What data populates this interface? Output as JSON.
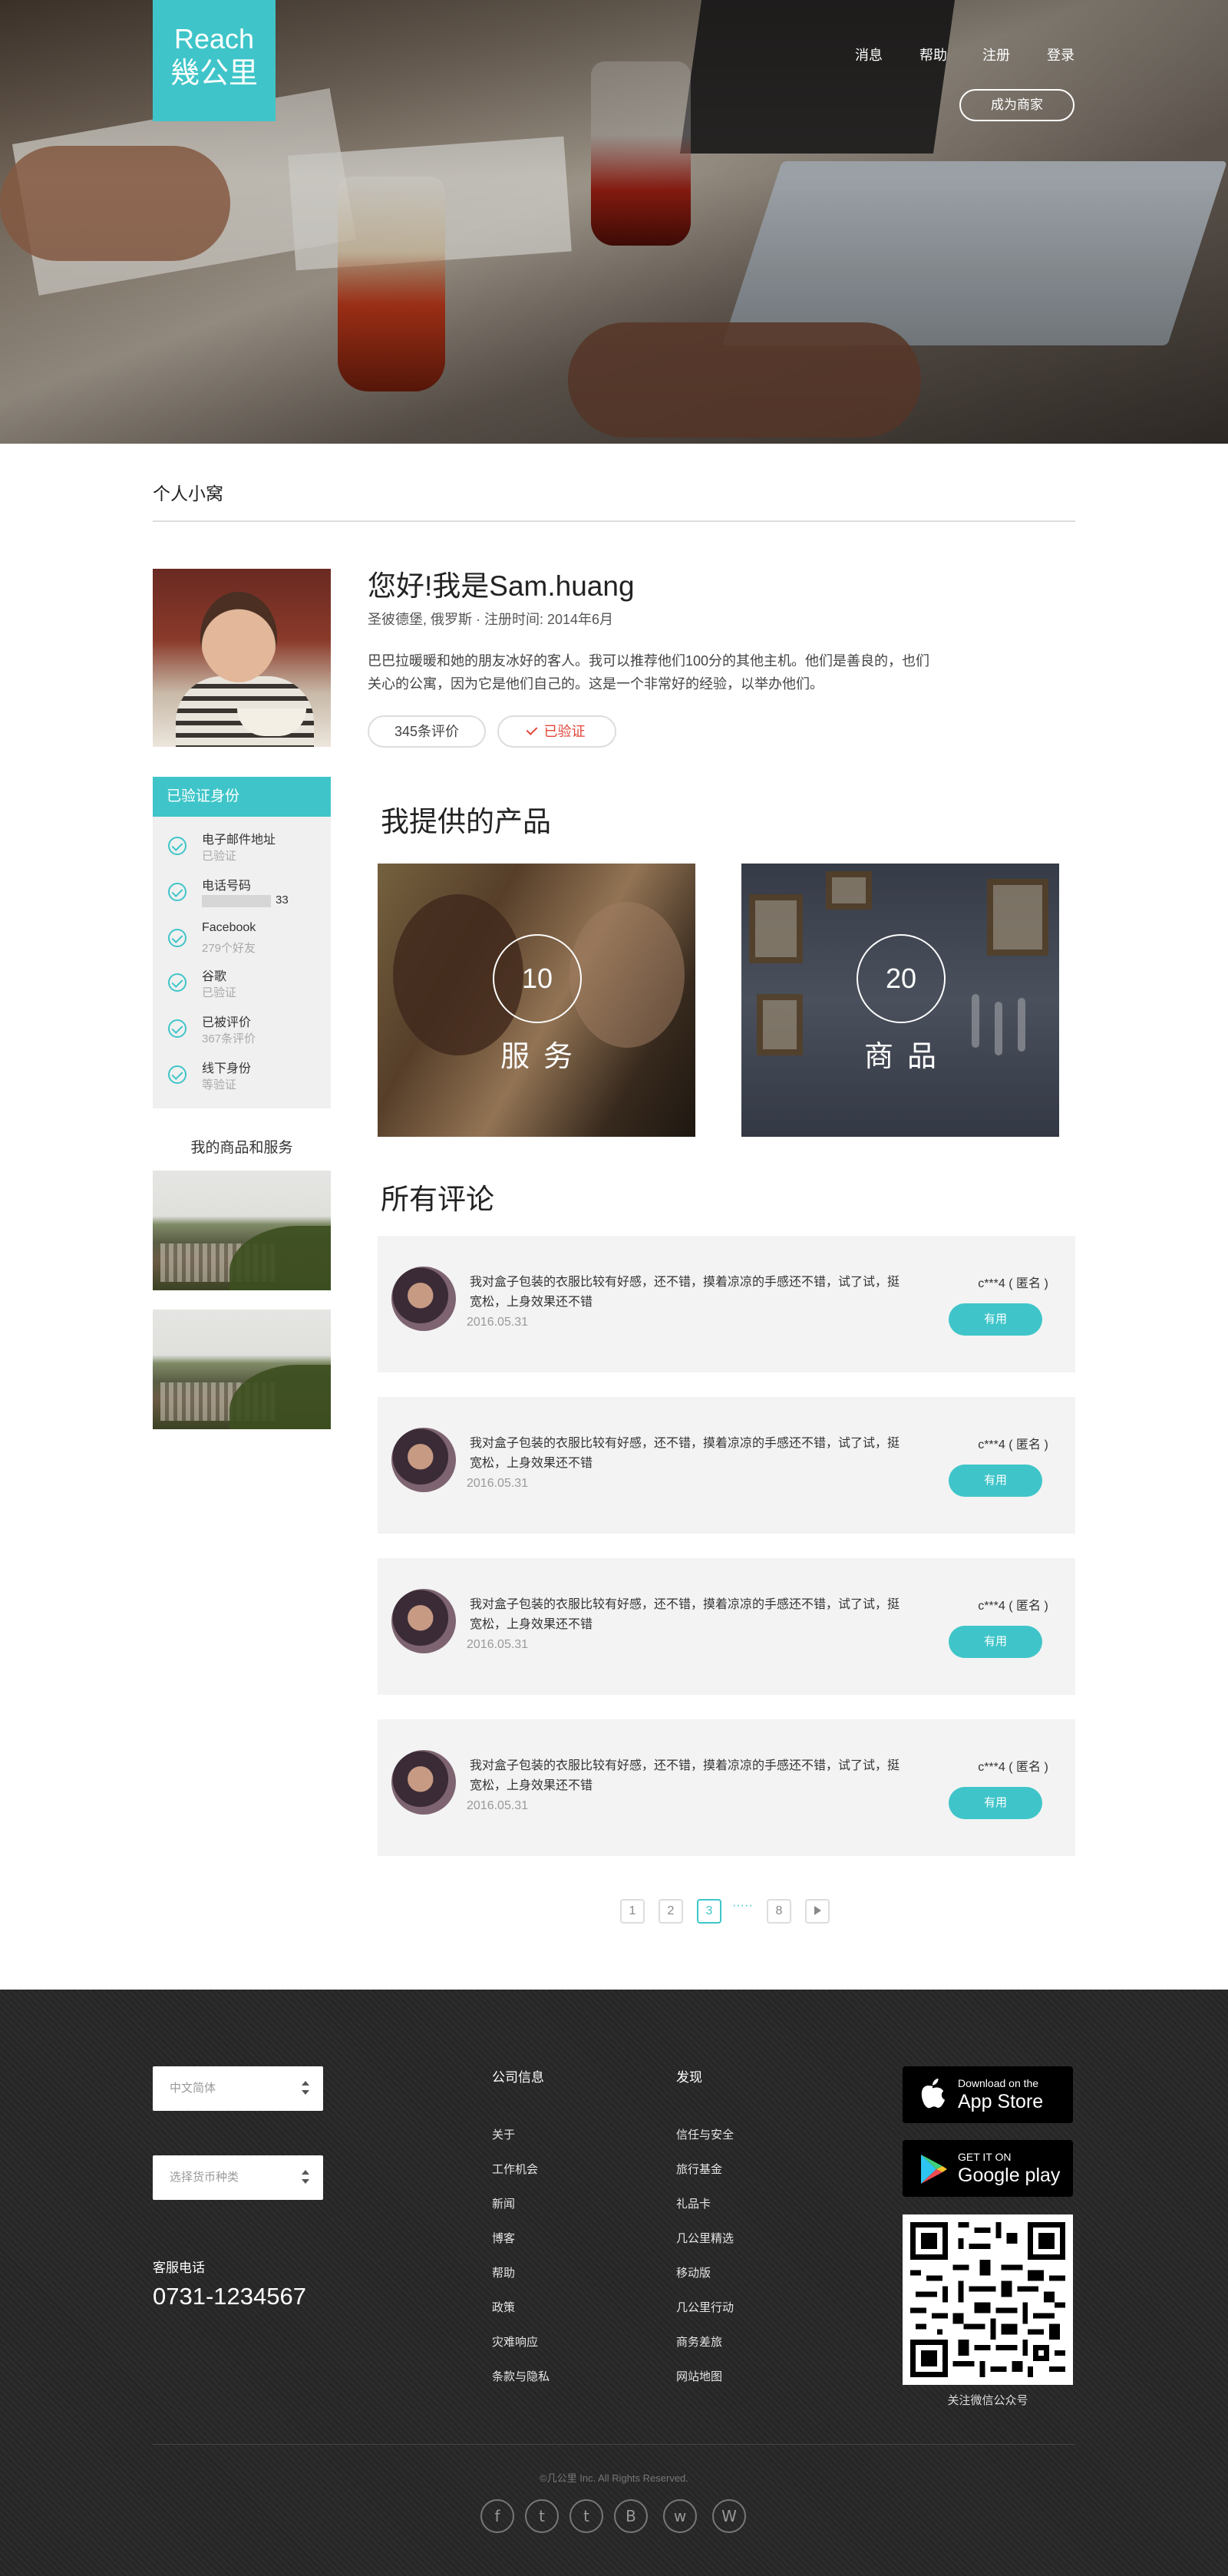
{
  "brand": {
    "line1": "Reach",
    "line2": "幾公里"
  },
  "topnav": {
    "messages": "消息",
    "help": "帮助",
    "register": "注册",
    "login": "登录",
    "become_merchant": "成为商家"
  },
  "section": {
    "title": "个人小窝"
  },
  "profile": {
    "greeting": "您好!我是Sam.huang",
    "meta": "圣彼德堡, 俄罗斯 · 注册时间: 2014年6月",
    "bio": "巴巴拉暖暖和她的朋友冰好的客人。我可以推荐他们100分的其他主机。他们是善良的，也们关心的公寓，因为它是他们自己的。这是一个非常好的经验，以举办他们。",
    "reviews_count": "345条评价",
    "verified": "已验证"
  },
  "verification": {
    "title": "已验证身份",
    "items": [
      {
        "label": "电子邮件地址",
        "sub": "已验证"
      },
      {
        "label": "电话号码",
        "sub": "33"
      },
      {
        "label": "Facebook",
        "sub": "279个好友"
      },
      {
        "label": "谷歌",
        "sub": "已验证"
      },
      {
        "label": "已被评价",
        "sub": "367条评价"
      },
      {
        "label": "线下身份",
        "sub": "等验证"
      }
    ]
  },
  "my_goods": {
    "title": "我的商品和服务"
  },
  "products": {
    "title": "我提供的产品",
    "items": [
      {
        "count": "10",
        "label": "服务"
      },
      {
        "count": "20",
        "label": "商品"
      }
    ]
  },
  "reviews": {
    "title": "所有评论",
    "items": [
      {
        "text": "我对盒子包装的衣服比较有好感，还不错，摸着凉凉的手感还不错，试了试，挺宽松，上身效果还不错",
        "date": "2016.05.31",
        "user": "c***4 ( 匿名 )",
        "helpful": "有用"
      },
      {
        "text": "我对盒子包装的衣服比较有好感，还不错，摸着凉凉的手感还不错，试了试，挺宽松，上身效果还不错",
        "date": "2016.05.31",
        "user": "c***4 ( 匿名 )",
        "helpful": "有用"
      },
      {
        "text": "我对盒子包装的衣服比较有好感，还不错，摸着凉凉的手感还不错，试了试，挺宽松，上身效果还不错",
        "date": "2016.05.31",
        "user": "c***4 ( 匿名 )",
        "helpful": "有用"
      },
      {
        "text": "我对盒子包装的衣服比较有好感，还不错，摸着凉凉的手感还不错，试了试，挺宽松，上身效果还不错",
        "date": "2016.05.31",
        "user": "c***4 ( 匿名 )",
        "helpful": "有用"
      }
    ]
  },
  "pagination": {
    "pages": [
      "1",
      "2",
      "3",
      "8"
    ],
    "current": "3",
    "ellipsis": "·····"
  },
  "footer": {
    "language_select": "中文简体",
    "currency_select": "选择货币种类",
    "hotline_label": "客服电话",
    "hotline": "0731-1234567",
    "col1": {
      "title": "公司信息",
      "links": [
        "关于",
        "工作机会",
        "新闻",
        "博客",
        "帮助",
        "政策",
        "灾难响应",
        "条款与隐私"
      ]
    },
    "col2": {
      "title": "发现",
      "links": [
        "信任与安全",
        "旅行基金",
        "礼品卡",
        "几公里精选",
        "移动版",
        "几公里行动",
        "商务差旅",
        "网站地图"
      ]
    },
    "app_store": {
      "small": "Download on the",
      "big": "App Store"
    },
    "google_play": {
      "small": "GET IT ON",
      "big": "Google play"
    },
    "qr_caption": "关注微信公众号",
    "copyright": "©几公里 Inc. All Rights Reserved.",
    "social": [
      {
        "icon": "facebook-icon",
        "glyph": "f"
      },
      {
        "icon": "twitter-icon",
        "glyph": "t"
      },
      {
        "icon": "tumblr-icon",
        "glyph": "t"
      },
      {
        "icon": "blogger-icon",
        "glyph": "B"
      },
      {
        "icon": "wechat-icon",
        "glyph": "w"
      },
      {
        "icon": "weibo-icon",
        "glyph": "W"
      }
    ]
  },
  "colors": {
    "accent": "#3fc5c9",
    "verified_red": "#e2463a",
    "footer_bg": "#2a2a2a"
  }
}
